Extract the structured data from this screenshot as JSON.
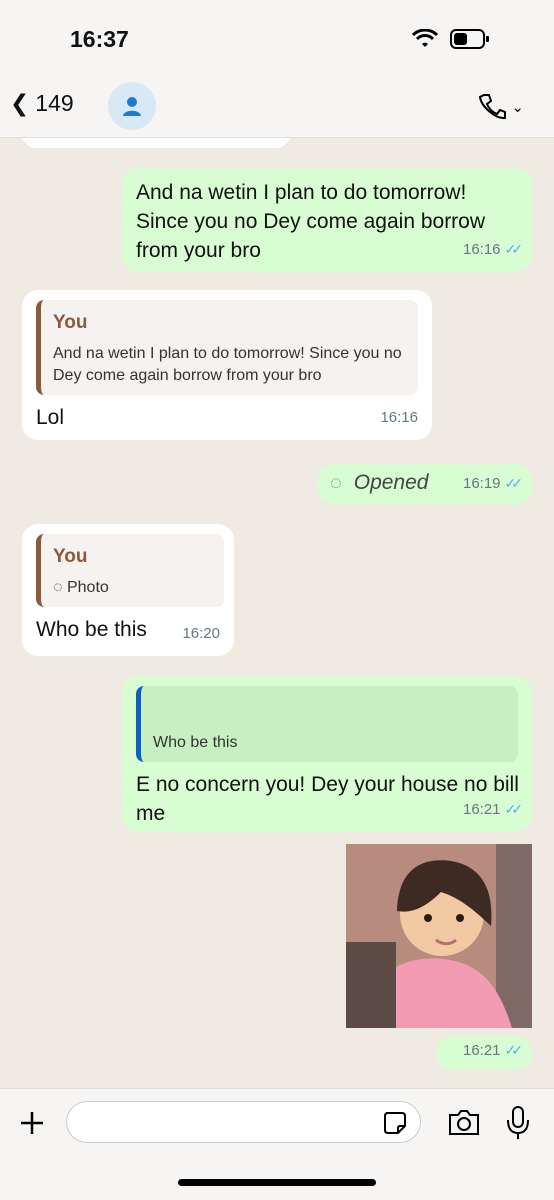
{
  "status": {
    "time": "16:37"
  },
  "header": {
    "back_count": "149",
    "contact_name": ""
  },
  "messages": {
    "m1": {
      "text": "And na wetin I plan to do tomorrow! Since you no Dey come again borrow from your bro",
      "time": "16:16"
    },
    "m2": {
      "quote_author": "You",
      "quote_text": "And na wetin I plan to do tomorrow! Since you no Dey come again borrow from your bro",
      "text": "Lol",
      "time": "16:16"
    },
    "m3": {
      "text": "Opened",
      "time": "16:19"
    },
    "m4": {
      "quote_author": "You",
      "quote_text": "Photo",
      "text": "Who be this",
      "time": "16:20"
    },
    "m5": {
      "quote_text": "Who be this",
      "text": "E no concern you! Dey your house no bill me",
      "time": "16:21"
    },
    "m6": {
      "time": "16:21"
    }
  },
  "colors": {
    "outgoing": "#d9fdd3",
    "incoming": "#ffffff",
    "read_tick": "#4fb6ec"
  }
}
